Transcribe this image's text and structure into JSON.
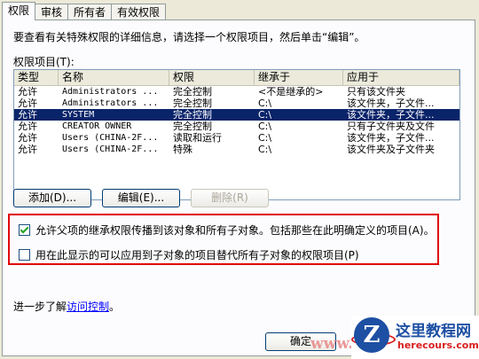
{
  "tabs": [
    "权限",
    "审核",
    "所有者",
    "有效权限"
  ],
  "intro_text": "要查看有关特殊权限的详细信息，请选择一个权限项目，然后单击“编辑”。",
  "list_label": "权限项目(T):",
  "columns": [
    "类型",
    "名称",
    "权限",
    "继承于",
    "应用于"
  ],
  "rows": [
    {
      "type": "允许",
      "name": "Administrators ...",
      "perm": "完全控制",
      "inherit": "<不是继承的>",
      "apply": "只有该文件夹",
      "selected": false
    },
    {
      "type": "允许",
      "name": "Administrators ...",
      "perm": "完全控制",
      "inherit": "C:\\",
      "apply": "该文件夹，子文件...",
      "selected": false
    },
    {
      "type": "允许",
      "name": "SYSTEM",
      "perm": "完全控制",
      "inherit": "C:\\",
      "apply": "该文件夹，子文件...",
      "selected": true
    },
    {
      "type": "允许",
      "name": "CREATOR OWNER",
      "perm": "完全控制",
      "inherit": "C:\\",
      "apply": "只有子文件夹及文件",
      "selected": false
    },
    {
      "type": "允许",
      "name": "Users (CHINA-2F...",
      "perm": "读取和运行",
      "inherit": "C:\\",
      "apply": "该文件夹，子文件...",
      "selected": false
    },
    {
      "type": "允许",
      "name": "Users (CHINA-2F...",
      "perm": "特殊",
      "inherit": "C:\\",
      "apply": "该文件夹及子文件夹",
      "selected": false
    }
  ],
  "buttons": {
    "add": "添加(D)...",
    "edit": "编辑(E)...",
    "remove": "删除(R)",
    "ok": "确定"
  },
  "checkbox1": {
    "label": "允许父项的继承权限传播到该对象和所有子对象。包括那些在此明确定义的项目(A)。",
    "checked": true
  },
  "checkbox2": {
    "label": "用在此显示的可以应用到子对象的项目替代所有子对象的权限项目(P)",
    "checked": false
  },
  "learn_prefix": "进一步了解",
  "learn_link": "访问控制",
  "learn_suffix": "。",
  "watermark": {
    "title": "这里教程网",
    "url": "herecours.com",
    "logo_letter": "Z",
    "faded": "www.c"
  },
  "colors": {
    "selection": "#0a246a",
    "highlight_box": "#e00000",
    "link": "#0000ff"
  }
}
